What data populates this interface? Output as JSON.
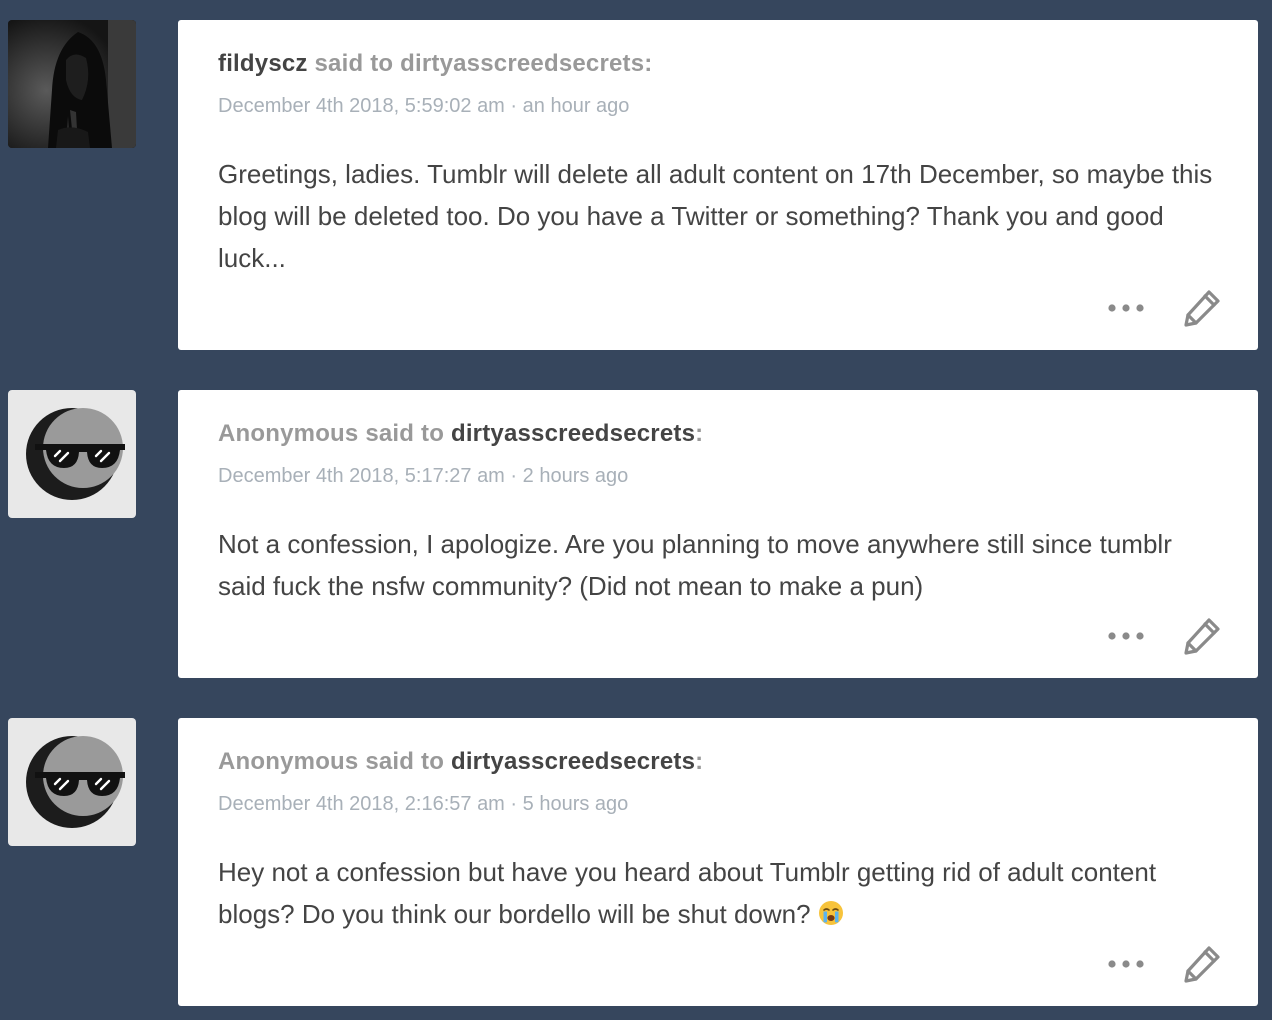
{
  "posts": [
    {
      "asker": "fildyscz",
      "said_to": " said to ",
      "recipient": "dirtyasscreedsecrets:",
      "recipient_colon": "",
      "date": "December 4th 2018, 5:59:02 am",
      "separator": " · ",
      "relative": "an hour ago",
      "body": "Greetings, ladies. Tumblr will delete all adult content on 17th December, so maybe this blog will be deleted too. Do you have a Twitter or something? Thank you and good luck...",
      "avatar": "hooded-figure-photo"
    },
    {
      "asker": "Anonymous",
      "said_to": " said to ",
      "recipient": "dirtyasscreedsecrets",
      "recipient_colon": ":",
      "date": "December 4th 2018, 5:17:27 am",
      "separator": " · ",
      "relative": "2 hours ago",
      "body": "Not a confession, I apologize. Are you planning to move anywhere still since tumblr said fuck the nsfw community? (Did not mean to make a pun)",
      "avatar": "anonymous-sunglasses-icon"
    },
    {
      "asker": "Anonymous",
      "said_to": " said to ",
      "recipient": "dirtyasscreedsecrets",
      "recipient_colon": ":",
      "date": "December 4th 2018, 2:16:57 am",
      "separator": " · ",
      "relative": "5 hours ago",
      "body": "Hey not a confession but have you heard about Tumblr getting rid of adult content blogs? Do you think our bordello will be shut down?",
      "emoji": "loudly-crying-face",
      "avatar": "anonymous-sunglasses-icon"
    }
  ],
  "icons": {
    "more": "more-options-icon",
    "edit": "pencil-icon"
  },
  "colors": {
    "background": "#36465d",
    "card": "#ffffff",
    "text": "#444444",
    "muted": "#999999",
    "meta": "#a8b0b8",
    "icon": "#8a8a8a"
  }
}
